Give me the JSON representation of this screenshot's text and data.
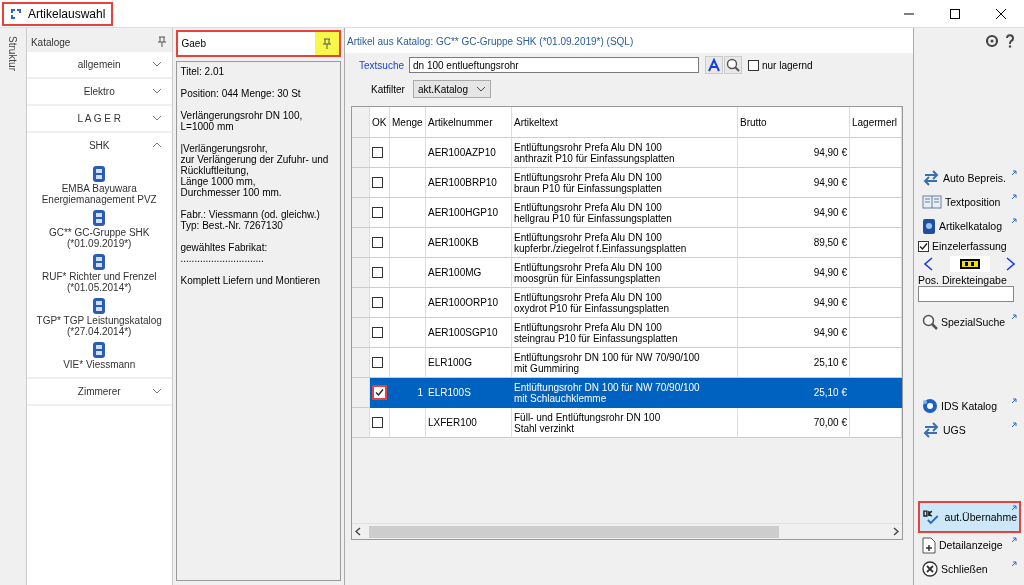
{
  "window": {
    "title": "Artikelauswahl",
    "highlighted": true
  },
  "structure_tab": {
    "label": "Struktur"
  },
  "catalogs": {
    "title": "Kataloge",
    "sections": [
      {
        "label": "allgemein",
        "expanded": false
      },
      {
        "label": "Elektro",
        "expanded": false
      },
      {
        "label": "L A G E R",
        "expanded": false
      },
      {
        "label": "SHK",
        "expanded": true,
        "items": [
          "EMBA Bayuwara Energiemanagement PVZ",
          "GC** GC-Gruppe SHK (*01.09.2019*)",
          "RUF* Richter und Frenzel (*01.05.2014*)",
          "TGP* TGP Leistungskatalog (*27.04.2014*)",
          "VIE* Viessmann"
        ]
      },
      {
        "label": "Zimmerer",
        "expanded": false
      }
    ]
  },
  "gaeb": {
    "title": "Gaeb",
    "highlighted": true,
    "paragraphs": [
      "Titel: 2.01",
      "Position: 044  Menge: 30 St",
      "Verlängerungsrohr DN 100, L=1000 mm",
      "|Verlängerungsrohr,\nzur Verlängerung der Zufuhr- und Rückluftleitung,\nLänge 1000 mm,\nDurchmesser 100 mm.",
      "Fabr.: Viessmann (od. gleichw.)\nTyp: Best.-Nr. 7267130",
      "gewähltes Fabrikat: ..............................",
      "Komplett Liefern und Montieren"
    ]
  },
  "main": {
    "header": "Artikel aus Katalog: GC** GC-Gruppe SHK (*01.09.2019*) (SQL)",
    "search": {
      "label": "Textsuche",
      "value": "dn 100 entlueftungsrohr"
    },
    "only_in_stock": {
      "label": "nur lagernd",
      "checked": false
    },
    "filter": {
      "label": "Katfilter",
      "value": "akt.Katalog"
    },
    "table": {
      "columns": [
        "OK",
        "Menge",
        "Artikelnummer",
        "Artikeltext",
        "Brutto",
        "Lagermerl"
      ],
      "rows": [
        {
          "selected": false,
          "checked": false,
          "highlighted": false,
          "quantity": "",
          "number": "AER100AZP10",
          "text": "Entlüftungsrohr Prefa Alu DN 100\nanthrazit P10 für Einfassungsplatten",
          "price": "94,90 €"
        },
        {
          "selected": false,
          "checked": false,
          "highlighted": false,
          "quantity": "",
          "number": "AER100BRP10",
          "text": "Entlüftungsrohr Prefa Alu DN 100\nbraun P10 für Einfassungsplatten",
          "price": "94,90 €"
        },
        {
          "selected": false,
          "checked": false,
          "highlighted": false,
          "quantity": "",
          "number": "AER100HGP10",
          "text": "Entlüftungsrohr Prefa Alu DN 100\nhellgrau P10 für Einfassungsplatten",
          "price": "94,90 €"
        },
        {
          "selected": false,
          "checked": false,
          "highlighted": false,
          "quantity": "",
          "number": "AER100KB",
          "text": "Entlüftungsrohr Prefa Alu DN 100\nkupferbr./ziegelrot f.Einfassungsplatten",
          "price": "89,50 €"
        },
        {
          "selected": false,
          "checked": false,
          "highlighted": false,
          "quantity": "",
          "number": "AER100MG",
          "text": "Entlüftungsrohr Prefa Alu DN 100\nmoosgrün für Einfassungsplatten",
          "price": "94,90 €"
        },
        {
          "selected": false,
          "checked": false,
          "highlighted": false,
          "quantity": "",
          "number": "AER100ORP10",
          "text": "Entlüftungsrohr Prefa Alu DN 100\noxydrot P10 für Einfassungsplatten",
          "price": "94,90 €"
        },
        {
          "selected": false,
          "checked": false,
          "highlighted": false,
          "quantity": "",
          "number": "AER100SGP10",
          "text": "Entlüftungsrohr Prefa Alu DN 100\nsteingrau P10 für Einfassungsplatten",
          "price": "94,90 €"
        },
        {
          "selected": false,
          "checked": false,
          "highlighted": false,
          "quantity": "",
          "number": "ELR100G",
          "text": "Entlüftungsrohr DN 100 für NW 70/90/100\nmit Gummiring",
          "price": "25,10 €"
        },
        {
          "selected": true,
          "checked": true,
          "highlighted": true,
          "quantity": "1",
          "number": "ELR100S",
          "text": "Entlüftungsrohr DN 100 für NW 70/90/100\nmit Schlauchklemme",
          "price": "25,10 €"
        },
        {
          "selected": false,
          "checked": false,
          "highlighted": false,
          "quantity": "",
          "number": "LXFER100",
          "text": "Füll- und Entlüftungsrohr DN 100\nStahl verzinkt",
          "price": "70,00 €"
        }
      ]
    }
  },
  "actions": [
    {
      "kind": "button",
      "label": "Auto Bepreis.",
      "selected": false,
      "highlighted": false
    },
    {
      "kind": "button",
      "label": "Textposition",
      "selected": false,
      "highlighted": false
    },
    {
      "kind": "button",
      "label": "Artikelkatalog",
      "selected": false,
      "highlighted": false
    },
    {
      "kind": "checkbox",
      "label": "Einzelerfassung",
      "checked": true
    },
    {
      "kind": "nav"
    },
    {
      "kind": "input",
      "label": "Pos. Direkteingabe"
    },
    {
      "kind": "button",
      "label": "SpezialSuche",
      "selected": false,
      "highlighted": false
    },
    {
      "kind": "spacer"
    },
    {
      "kind": "button",
      "label": "IDS Katalog",
      "selected": false,
      "highlighted": false
    },
    {
      "kind": "button",
      "label": "UGS",
      "selected": false,
      "highlighted": false
    },
    {
      "kind": "spacer"
    },
    {
      "kind": "button",
      "label": "aut.Übernahme",
      "selected": true,
      "highlighted": true
    },
    {
      "kind": "button",
      "label": "Detailanzeige",
      "selected": false,
      "highlighted": false
    },
    {
      "kind": "button",
      "label": "Schließen",
      "selected": false,
      "highlighted": false
    }
  ]
}
